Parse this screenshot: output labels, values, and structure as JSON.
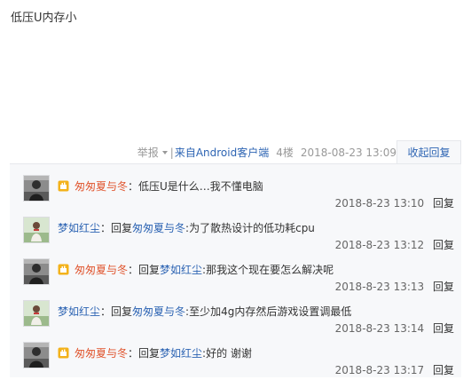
{
  "post": {
    "content": "低压U内存小"
  },
  "meta": {
    "report": "举报",
    "separator": "|",
    "client": "来自Android客户端",
    "floor": "4楼",
    "date": "2018-08-23 13:09",
    "collapse": "收起回复"
  },
  "replies": [
    {
      "user": "匆匆夏与冬",
      "user_color": "red",
      "has_badge": true,
      "reply_word": "",
      "target": "",
      "text": "：低压U是什么…我不懂电脑",
      "time": "2018-8-23 13:10",
      "reply_link": "回复"
    },
    {
      "user": "梦如红尘",
      "user_color": "blue",
      "has_badge": false,
      "reply_word": "：回复 ",
      "target": "匆匆夏与冬",
      "text": " :为了散热设计的低功耗cpu",
      "time": "2018-8-23 13:12",
      "reply_link": "回复"
    },
    {
      "user": "匆匆夏与冬",
      "user_color": "red",
      "has_badge": true,
      "reply_word": "：回复 ",
      "target": "梦如红尘",
      "text": " :那我这个现在要怎么解决呢",
      "time": "2018-8-23 13:13",
      "reply_link": "回复"
    },
    {
      "user": "梦如红尘",
      "user_color": "blue",
      "has_badge": false,
      "reply_word": "：回复 ",
      "target": "匆匆夏与冬",
      "text": " :至少加4g内存然后游戏设置调最低",
      "time": "2018-8-23 13:14",
      "reply_link": "回复"
    },
    {
      "user": "匆匆夏与冬",
      "user_color": "red",
      "has_badge": true,
      "reply_word": "：回复 ",
      "target": "梦如红尘",
      "text": " :好的 谢谢",
      "time": "2018-8-23 13:17",
      "reply_link": "回复"
    }
  ],
  "icons": {
    "badge": "gold-hand-badge-icon",
    "caret": "caret-down-icon"
  },
  "colors": {
    "link_blue": "#2d64b3",
    "name_red": "#e0552e",
    "panel_bg": "#f7f8fa"
  }
}
